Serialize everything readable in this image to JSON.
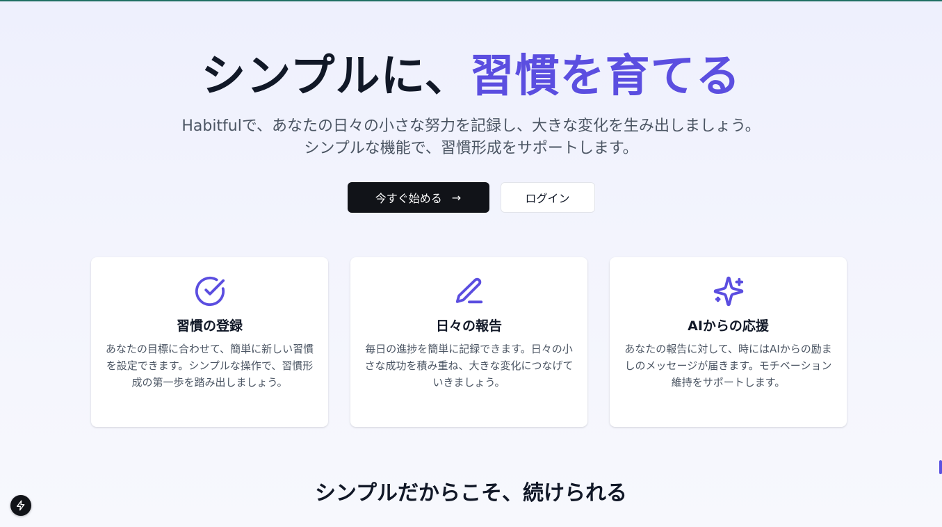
{
  "hero": {
    "title_main": "シンプルに、",
    "title_accent": "習慣を育てる",
    "subtitle_line1": "Habitfulで、あなたの日々の小さな努力を記録し、大きな変化を生み出しましょう。",
    "subtitle_line2": "シンプルな機能で、習慣形成をサポートします。",
    "primary_button": "今すぐ始める",
    "primary_button_arrow": "→",
    "secondary_button": "ログイン"
  },
  "features": [
    {
      "icon": "check-circle-icon",
      "title": "習慣の登録",
      "description": "あなたの目標に合わせて、簡単に新しい習慣を設定できます。シンプルな操作で、習慣形成の第一歩を踏み出しましょう。"
    },
    {
      "icon": "pencil-icon",
      "title": "日々の報告",
      "description": "毎日の進捗を簡単に記録できます。日々の小さな成功を積み重ね、大きな変化につなげていきましょう。"
    },
    {
      "icon": "sparkles-icon",
      "title": "AIからの応援",
      "description": "あなたの報告に対して、時にはAIからの励ましのメッセージが届きます。モチベーション維持をサポートします。"
    }
  ],
  "section": {
    "title": "シンプルだからこそ、続けられる"
  },
  "colors": {
    "accent": "#5b4ee0",
    "dark": "#111318",
    "text_muted": "#4b5563"
  },
  "fab_icon": "lightning-icon"
}
